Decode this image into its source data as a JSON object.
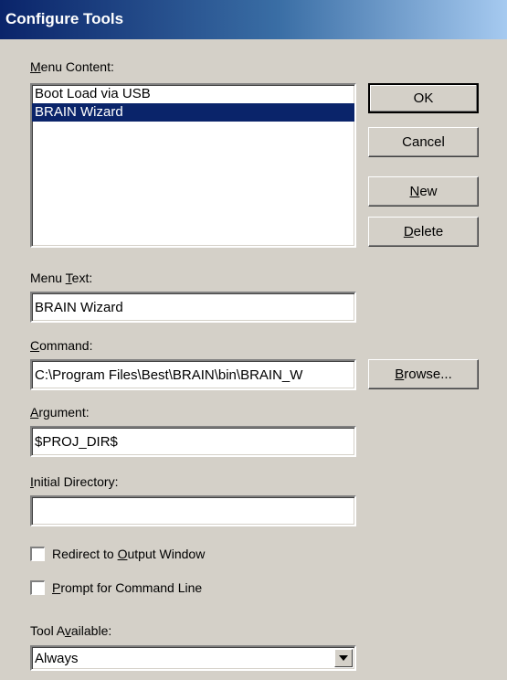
{
  "window": {
    "title": "Configure Tools"
  },
  "menu_content": {
    "label_accel": "M",
    "label_rest": "enu Content:",
    "items": [
      {
        "label": "Boot Load via USB",
        "selected": false
      },
      {
        "label": "BRAIN Wizard",
        "selected": true
      }
    ]
  },
  "buttons": {
    "ok": "OK",
    "cancel": "Cancel",
    "new_accel": "N",
    "new_rest": "ew",
    "delete_accel": "D",
    "delete_rest": "elete",
    "browse_accel": "B",
    "browse_rest": "rowse..."
  },
  "menu_text": {
    "label_pre": "Menu ",
    "label_accel": "T",
    "label_rest": "ext:",
    "value": "BRAIN Wizard"
  },
  "command": {
    "label_accel": "C",
    "label_rest": "ommand:",
    "value": "C:\\Program Files\\Best\\BRAIN\\bin\\BRAIN_W"
  },
  "argument": {
    "label_accel": "A",
    "label_rest": "rgument:",
    "value": "$PROJ_DIR$"
  },
  "initial_directory": {
    "label_accel": "I",
    "label_rest": "nitial Directory:",
    "value": ""
  },
  "redirect_output": {
    "label_pre": "Redirect to ",
    "label_accel": "O",
    "label_rest": "utput Window",
    "checked": false
  },
  "prompt_command_line": {
    "label_accel": "P",
    "label_rest": "rompt for Command Line",
    "checked": false
  },
  "tool_available": {
    "label_pre": "Tool A",
    "label_accel": "v",
    "label_rest": "ailable:",
    "value": "Always"
  }
}
